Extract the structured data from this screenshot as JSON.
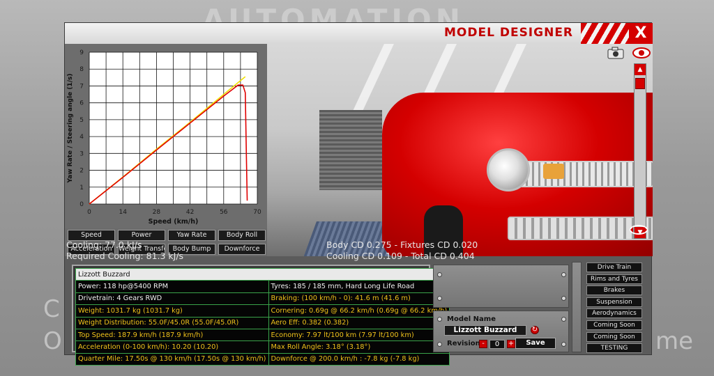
{
  "background": {
    "logo": "AUTOMATION",
    "left_text_1": "C",
    "left_text_2": "O",
    "right_text": "me"
  },
  "window": {
    "title": "MODEL DESIGNER",
    "close_label": "X"
  },
  "chart_data": {
    "type": "line",
    "xlabel": "Speed (km/h)",
    "ylabel": "Yaw Rate / Steering angle (1/s)",
    "xlim": [
      0,
      70
    ],
    "ylim": [
      0,
      9
    ],
    "x_ticks": [
      "0",
      "14",
      "28",
      "42",
      "56",
      "70"
    ],
    "y_ticks": [
      "0",
      "1",
      "2",
      "3",
      "4",
      "5",
      "6",
      "7",
      "8",
      "9"
    ],
    "grid": true,
    "series": [
      {
        "color": "#f0e000",
        "x": [
          0,
          14,
          28,
          42,
          56,
          65
        ],
        "y": [
          0,
          1.6,
          3.25,
          4.85,
          6.5,
          7.55
        ]
      },
      {
        "color": "#e00000",
        "x": [
          0,
          14,
          28,
          42,
          56,
          62,
          64,
          65,
          65.5,
          65.8
        ],
        "y": [
          0,
          1.58,
          3.2,
          4.8,
          6.4,
          7.05,
          7.05,
          6.6,
          2.5,
          0.2
        ]
      }
    ]
  },
  "graph_buttons": [
    "Speed",
    "Power",
    "Yaw Rate",
    "Body Roll",
    "Acceleration",
    "Weight Transfer",
    "Body Bump",
    "Downforce"
  ],
  "info": {
    "cooling": "Cooling: 77.0 kJ/s",
    "required_cooling": "Required Cooling: 81.3 kJ/s",
    "body_cd": "Body CD 0.275 - Fixtures CD 0.020",
    "cooling_cd": "Cooling CD 0.109 - Total CD 0.404"
  },
  "stats": {
    "title": "Lizzott Buzzard",
    "rows": [
      [
        {
          "text": "Power: 118 hp@5400 RPM",
          "color": "white"
        },
        {
          "text": "Tyres: 185 / 185 mm, Hard Long Life Road",
          "color": "white"
        }
      ],
      [
        {
          "text": "Drivetrain: 4 Gears RWD",
          "color": "white"
        },
        {
          "text": "Braking: (100 km/h - 0): 41.6 m (41.6 m)",
          "color": "yellow"
        }
      ],
      [
        {
          "text": "Weight: 1031.7 kg (1031.7 kg)",
          "color": "yellow"
        },
        {
          "text": "Cornering: 0.69g @ 66.2 km/h (0.69g @ 66.2 km/h)",
          "color": "yellow"
        }
      ],
      [
        {
          "text": "Weight Distribution: 55.0F/45.0R (55.0F/45.0R)",
          "color": "yellow"
        },
        {
          "text": "Aero Eff: 0.382 (0.382)",
          "color": "yellow"
        }
      ],
      [
        {
          "text": "Top Speed: 187.9 km/h (187.9 km/h)",
          "color": "yellow"
        },
        {
          "text": "Economy: 7.97 lt/100 km (7.97 lt/100 km)",
          "color": "yellow"
        }
      ],
      [
        {
          "text": "Acceleration (0-100 km/h): 10.20 (10.20)",
          "color": "yellow"
        },
        {
          "text": "Max Roll Angle: 3.18° (3.18°)",
          "color": "yellow"
        }
      ],
      [
        {
          "text": "Quarter Mile: 17.50s @ 130 km/h (17.50s @ 130 km/h)",
          "color": "yellow"
        },
        {
          "text": "Downforce @ 200.0 km/h : -7.8 kg (-7.8 kg)",
          "color": "yellow"
        }
      ]
    ]
  },
  "model": {
    "label": "Model Name",
    "name": "Lizzott Buzzard",
    "revision_label": "Revision",
    "revision": "0",
    "minus": "-",
    "plus": "+",
    "save": "Save"
  },
  "side_menu": [
    "Drive Train",
    "Rims and Tyres",
    "Brakes",
    "Suspension",
    "Aerodynamics",
    "Coming Soon",
    "Coming Soon",
    "TESTING"
  ],
  "colors": {
    "accent": "#d40000",
    "grid_border": "#3aa34a",
    "highlight": "#f0c21b"
  }
}
